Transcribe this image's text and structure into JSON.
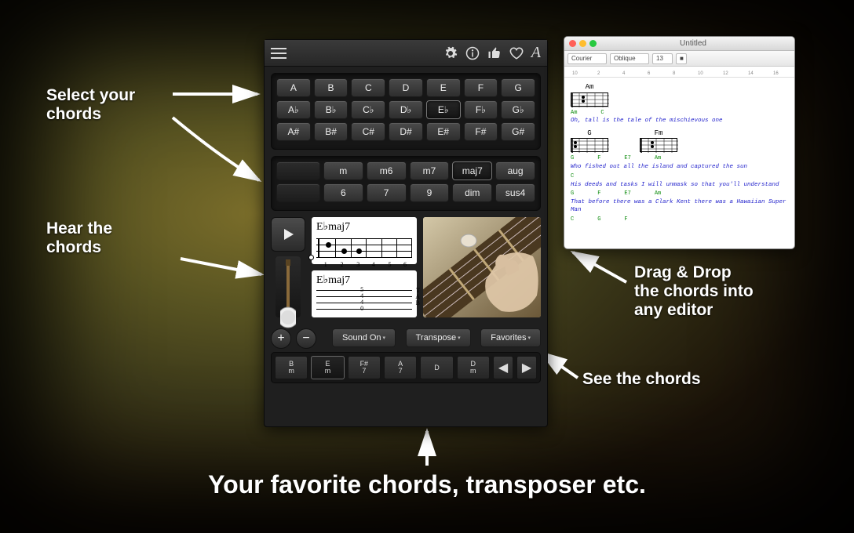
{
  "callouts": {
    "select": "Select your\nchords",
    "hear": "Hear the\nchords",
    "dragdrop": "Drag & Drop\nthe chords into\nany editor",
    "see": "See the chords",
    "favorites": "Your favorite chords, transposer  etc."
  },
  "app": {
    "noteRows": [
      [
        "A",
        "B",
        "C",
        "D",
        "E",
        "F",
        "G"
      ],
      [
        "A♭",
        "B♭",
        "C♭",
        "D♭",
        "E♭",
        "F♭",
        "G♭"
      ],
      [
        "A#",
        "B#",
        "C#",
        "D#",
        "E#",
        "F#",
        "G#"
      ]
    ],
    "selectedNote": "E♭",
    "qualityRows": [
      [
        "",
        "m",
        "m6",
        "m7",
        "maj7",
        "aug"
      ],
      [
        "",
        "6",
        "7",
        "9",
        "dim",
        "sus4"
      ]
    ],
    "selectedQuality": "maj7",
    "chordLabel": "E♭maj7",
    "tabLabel": "E♭maj7",
    "bottom": {
      "soundOn": "Sound On",
      "transpose": "Transpose",
      "favorites": "Favorites",
      "slots": [
        {
          "root": "B",
          "q": "m"
        },
        {
          "root": "E",
          "q": "m"
        },
        {
          "root": "F#",
          "q": "7"
        },
        {
          "root": "A",
          "q": "7"
        },
        {
          "root": "D",
          "q": ""
        },
        {
          "root": "D",
          "q": "m"
        }
      ],
      "selectedSlot": 1
    }
  },
  "editor": {
    "title": "Untitled",
    "font": "Courier",
    "style": "Oblique",
    "size": "13",
    "chordDiagrams": [
      "Am",
      "G",
      "Fm"
    ],
    "lines": [
      {
        "chords": [
          "Am",
          "C"
        ],
        "lyric": "Oh, tall is the tale of the mischievous one"
      },
      {
        "chords": [
          "G",
          "F",
          "E7",
          "Am"
        ],
        "lyric": "Who fished out all the island and captured the sun"
      },
      {
        "chords": [
          "C"
        ],
        "lyric": "His deeds and tasks I will unmask so that you'll understand"
      },
      {
        "chords": [
          "G",
          "F",
          "E7",
          "Am"
        ],
        "lyric": "That before there was a Clark Kent there was a Hawaiian Super Man"
      },
      {
        "chords": [
          "C",
          "G",
          "F"
        ],
        "lyric": ""
      }
    ]
  }
}
